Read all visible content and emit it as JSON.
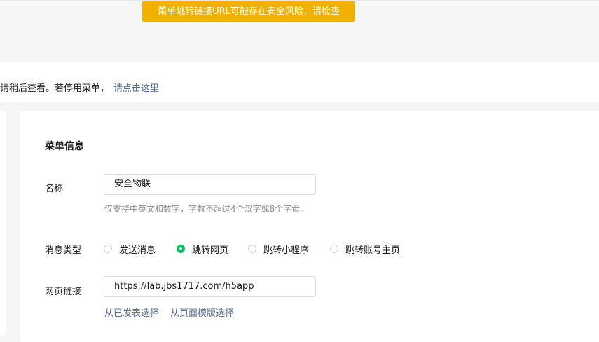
{
  "toast": {
    "message": "菜单跳转链接URL可能存在安全风险，请检查"
  },
  "notice": {
    "text": "请稍后查看。若停用菜单，",
    "link": "请点击这里"
  },
  "menu_info": {
    "section_title": "菜单信息",
    "name_label": "名称",
    "name_value": "安全物联",
    "name_hint": "仅支持中英文和数字，字数不超过4个汉字或8个字母。",
    "message_type_label": "消息类型",
    "message_type_options": [
      {
        "label": "发送消息",
        "checked": false
      },
      {
        "label": "跳转网页",
        "checked": true
      },
      {
        "label": "跳转小程序",
        "checked": false
      },
      {
        "label": "跳转账号主页",
        "checked": false
      }
    ],
    "url_label": "网页链接",
    "url_value": "https://lab.jbs1717.com/h5app",
    "select_from_published": "从已发表选择",
    "select_from_template": "从页面模版选择"
  },
  "colors": {
    "toast_bg": "#f0b100",
    "radio_checked": "#07c160",
    "link": "#576b95"
  }
}
